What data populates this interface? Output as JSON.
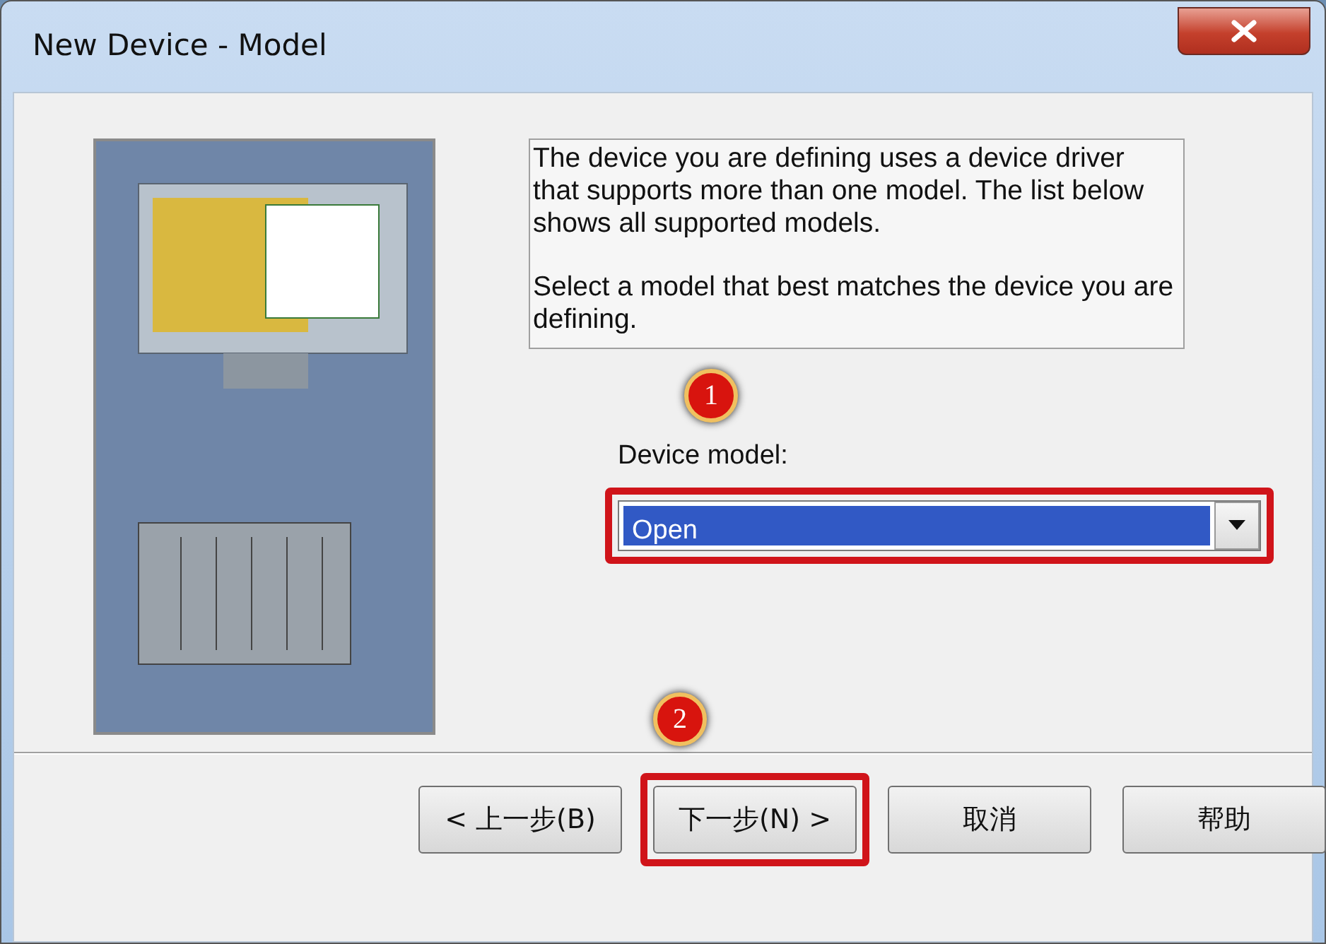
{
  "window": {
    "title": "New Device - Model"
  },
  "description": {
    "paragraphs": [
      "The device you are defining uses a device driver that supports more than one model.  The list below shows all supported models.",
      "Select  a model that best matches the device you are defining."
    ]
  },
  "device_model": {
    "label": "Device model:",
    "value": "Open",
    "highlighted": true,
    "callout": "1"
  },
  "buttons": [
    {
      "label": "< 上一步(B)",
      "highlighted": false
    },
    {
      "label": "下一步(N) >",
      "highlighted": true,
      "callout": "2"
    },
    {
      "label": "取消",
      "highlighted": false
    },
    {
      "label": "帮助",
      "highlighted": false
    }
  ]
}
